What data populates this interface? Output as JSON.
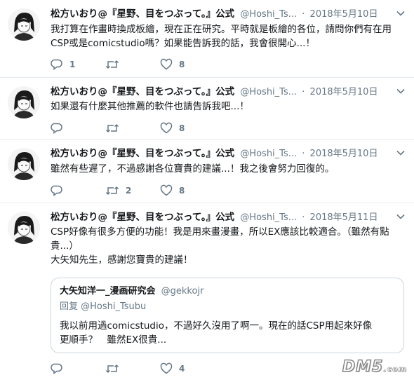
{
  "icons": [
    "reply-icon",
    "retweet-icon",
    "like-icon",
    "caret-down-icon"
  ],
  "colors": {
    "text": "#14171a",
    "secondary": "#657786",
    "border": "#e6ecf0"
  },
  "tweets": [
    {
      "name": "松方いおり@『星野、目をつぶって。』公式",
      "handle": "@Hoshi_Ts...",
      "sep": "·",
      "date": "2018年5月10日",
      "text_lines": [
        "我打算在作畫時換成板繪，現在正在研究。平時就是板繪的各位，請問你們有在用",
        "CSP或是comicstudio嗎？如果能告訴我的話，我會很開心...！"
      ],
      "reply_count": "1",
      "retweet_count": "",
      "like_count": "8"
    },
    {
      "name": "松方いおり@『星野、目をつぶって。』公式",
      "handle": "@Hoshi_Ts...",
      "sep": "·",
      "date": "2018年5月10日",
      "text_lines": [
        "如果還有什麼其他推薦的軟件也請告訴我吧...！"
      ],
      "reply_count": "",
      "retweet_count": "",
      "like_count": "8"
    },
    {
      "name": "松方いおり@『星野、目をつぶって。』公式",
      "handle": "@Hoshi_Ts...",
      "sep": "·",
      "date": "2018年5月10日",
      "text_lines": [
        "雖然有些遲了，不過感謝各位寶貴的建議...！我之後會努力回復的。"
      ],
      "reply_count": "",
      "retweet_count": "2",
      "like_count": "8"
    },
    {
      "name": "松方いおり@『星野、目をつぶって。』公式",
      "handle": "@Hoshi_Ts...",
      "sep": "·",
      "date": "2018年5月11日",
      "text_lines": [
        "CSP好像有很多方便的功能！我是用來畫漫畫，所以EX應該比較適合。（雖然有點",
        "貴...）",
        "大矢知先生，感謝您寶貴的建議！"
      ],
      "reply_count": "",
      "retweet_count": "",
      "like_count": "4",
      "quote": {
        "name": "大矢知洋一_漫画研究会",
        "handle": "@gekkojr",
        "reply_to": "回复 @Hoshi_Tsubu",
        "text_lines": [
          "我以前用過comicstudio，不過好久沒用了啊一。現在的話CSP用起來好像",
          "更順手？　雖然EX很貴..."
        ]
      }
    }
  ],
  "watermark": {
    "main": "DM5",
    "suffix": ".com"
  }
}
